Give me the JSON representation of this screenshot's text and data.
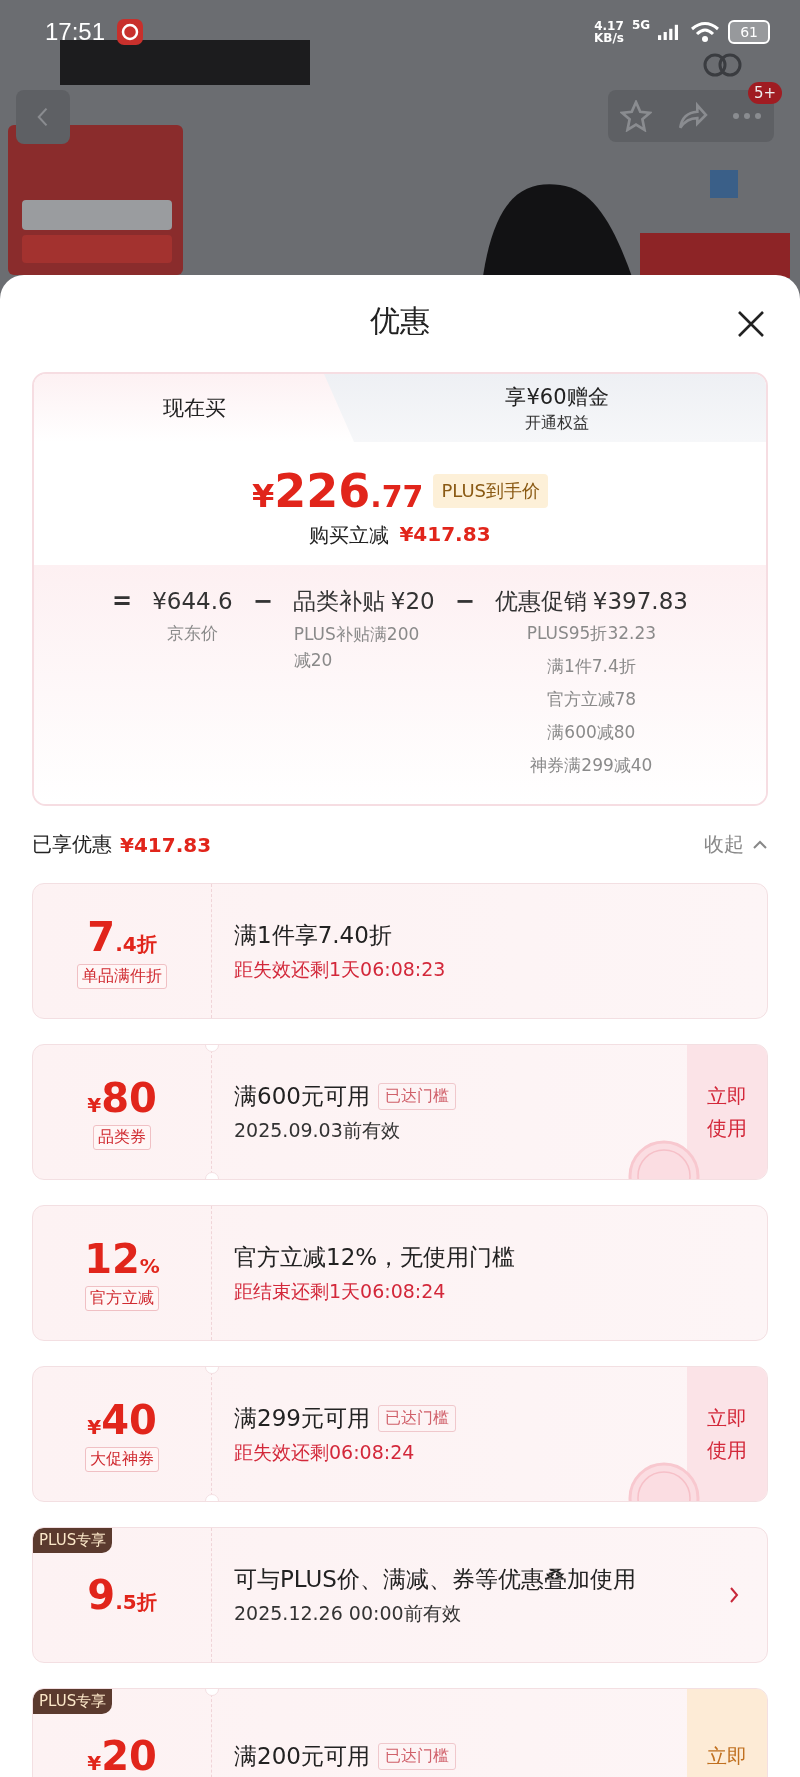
{
  "status_bar": {
    "time": "17:51",
    "net_speed": "4.17",
    "net_unit": "KB/s",
    "network": "5G",
    "battery": "61"
  },
  "nav": {
    "badge": "5+"
  },
  "sheet": {
    "title": "优惠"
  },
  "tabs": [
    {
      "label": "现在买",
      "selected": true
    },
    {
      "label": "享¥60赠金",
      "sublabel": "开通权益",
      "selected": false
    }
  ],
  "price": {
    "currency": "¥",
    "integer": "226",
    "decimal": ".77",
    "tag": "PLUS到手价",
    "saving_label": "购买立减",
    "saving": "¥417.83"
  },
  "breakdown": [
    {
      "op": "=",
      "amount": "¥644.6",
      "details": [
        "京东价"
      ]
    },
    {
      "op": "−",
      "label": "品类补贴",
      "amount": "¥20",
      "details": [
        "PLUS补贴满200减20"
      ]
    },
    {
      "op": "−",
      "label": "优惠促销",
      "amount": "¥397.83",
      "details": [
        "PLUS95折32.23",
        "满1件7.4折",
        "官方立减78",
        "满600减80",
        "神券满299减40"
      ]
    }
  ],
  "summary": {
    "label": "已享优惠",
    "amount": "¥417.83",
    "toggle": "收起",
    "expanded": true
  },
  "coupons": [
    {
      "kind": "discount",
      "value": "7",
      "suffix": ".4折",
      "tag": "单品满件折",
      "title": "满1件享7.40折",
      "subtitle": "距失效还剩1天06:08:23",
      "subtitle_urgent": true
    },
    {
      "kind": "coupon",
      "prefix": "¥",
      "value": "80",
      "tag": "品类券",
      "title": "满600元可用",
      "threshold": "已达门槛",
      "subtitle": "2025.09.03前有效",
      "subtitle_urgent": false,
      "action": {
        "kind": "button",
        "label": "立即使用"
      },
      "claimed": true
    },
    {
      "kind": "discount",
      "value": "12",
      "suffix": "%",
      "tag": "官方立减",
      "title": "官方立减12%，无使用门槛",
      "subtitle": "距结束还剩1天06:08:24",
      "subtitle_urgent": true
    },
    {
      "kind": "coupon",
      "prefix": "¥",
      "value": "40",
      "tag": "大促神券",
      "title": "满299元可用",
      "threshold": "已达门槛",
      "subtitle": "距失效还剩06:08:24",
      "subtitle_urgent": true,
      "action": {
        "kind": "button",
        "label": "立即使用"
      },
      "claimed": true
    },
    {
      "kind": "discount",
      "badge": "PLUS专享",
      "value": "9",
      "suffix": ".5折",
      "title": "可与PLUS价、满减、券等优惠叠加使用",
      "subtitle": "2025.12.26 00:00前有效",
      "subtitle_urgent": false,
      "action": {
        "kind": "chevron"
      }
    },
    {
      "kind": "coupon",
      "badge": "PLUS专享",
      "prefix": "¥",
      "value": "20",
      "title": "满200元可用",
      "threshold": "已达门槛",
      "action": {
        "kind": "button",
        "label": "立即"
      }
    }
  ]
}
